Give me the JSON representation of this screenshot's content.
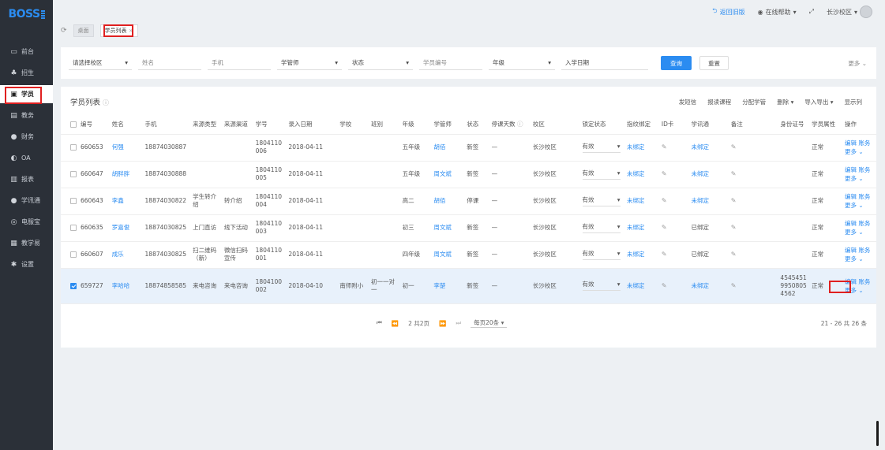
{
  "logo": {
    "text": "BOSS"
  },
  "sidebar": {
    "items": [
      {
        "label": "前台",
        "icon": "calendar-icon"
      },
      {
        "label": "招生",
        "icon": "users-icon"
      },
      {
        "label": "学员",
        "icon": "id-card-icon"
      },
      {
        "label": "教务",
        "icon": "book-icon"
      },
      {
        "label": "财务",
        "icon": "money-icon"
      },
      {
        "label": "OA",
        "icon": "toggle-icon"
      },
      {
        "label": "报表",
        "icon": "bar-chart-icon"
      },
      {
        "label": "学讯通",
        "icon": "message-icon"
      },
      {
        "label": "电服宝",
        "icon": "phone-icon"
      },
      {
        "label": "教学易",
        "icon": "teach-icon"
      },
      {
        "label": "设置",
        "icon": "gear-icon"
      }
    ]
  },
  "topbar": {
    "back": "返回旧版",
    "help": "在线帮助",
    "campus": "长沙校区"
  },
  "tabs": {
    "home": "桌面",
    "current": "学员列表"
  },
  "filter": {
    "campus": "请选择校区",
    "name": "姓名",
    "phone": "手机",
    "manager": "学管师",
    "status": "状态",
    "student_no": "学员编号",
    "grade": "年级",
    "enroll_date": "入学日期",
    "query": "查询",
    "reset": "重置",
    "more": "更多"
  },
  "panel": {
    "title": "学员列表",
    "actions": [
      "发短信",
      "报读课程",
      "分配学管",
      "删除",
      "导入导出",
      "显示列"
    ]
  },
  "table": {
    "headers": [
      "编号",
      "姓名",
      "手机",
      "来源类型",
      "来源渠道",
      "学号",
      "录入日期",
      "学校",
      "班别",
      "年级",
      "学管师",
      "状态",
      "停课天数",
      "校区",
      "锁定状态",
      "指纹绑定",
      "ID卡",
      "学讯通",
      "备注",
      "身份证号",
      "学员属性",
      "操作"
    ],
    "rows": [
      {
        "id": "660653",
        "name": "何强",
        "phone": "18874030887",
        "src_type": "",
        "src_channel": "",
        "sno": "1804110006",
        "date": "2018-04-11",
        "school": "",
        "class": "",
        "grade": "五年级",
        "mgr": "胡佰",
        "status": "新签",
        "stop": "—",
        "campus": "长沙校区",
        "lock": "有效",
        "finger": "未绑定",
        "xxt": "未绑定",
        "idno": "",
        "attr": "正常"
      },
      {
        "id": "660647",
        "name": "胡胖胖",
        "phone": "18874030888",
        "src_type": "",
        "src_channel": "",
        "sno": "1804110005",
        "date": "2018-04-11",
        "school": "",
        "class": "",
        "grade": "五年级",
        "mgr": "周文斌",
        "status": "新签",
        "stop": "—",
        "campus": "长沙校区",
        "lock": "有效",
        "finger": "未绑定",
        "xxt": "未绑定",
        "idno": "",
        "attr": "正常"
      },
      {
        "id": "660643",
        "name": "李鑫",
        "phone": "18874030822",
        "src_type": "学生转介绍",
        "src_channel": "转介绍",
        "sno": "1804110004",
        "date": "2018-04-11",
        "school": "",
        "class": "",
        "grade": "高二",
        "mgr": "胡佰",
        "status": "停课",
        "stop": "—",
        "campus": "长沙校区",
        "lock": "有效",
        "finger": "未绑定",
        "xxt": "未绑定",
        "idno": "",
        "attr": "正常"
      },
      {
        "id": "660635",
        "name": "罗嘉俊",
        "phone": "18874030825",
        "src_type": "上门直访",
        "src_channel": "线下活动",
        "sno": "1804110003",
        "date": "2018-04-11",
        "school": "",
        "class": "",
        "grade": "初三",
        "mgr": "周文斌",
        "status": "新签",
        "stop": "—",
        "campus": "长沙校区",
        "lock": "有效",
        "finger": "未绑定",
        "xxt": "已绑定",
        "idno": "",
        "attr": "正常"
      },
      {
        "id": "660607",
        "name": "成乐",
        "phone": "18874030825",
        "src_type": "扫二维码（新）",
        "src_channel": "微信扫码宣传",
        "sno": "1804110001",
        "date": "2018-04-11",
        "school": "",
        "class": "",
        "grade": "四年级",
        "mgr": "周文斌",
        "status": "新签",
        "stop": "—",
        "campus": "长沙校区",
        "lock": "有效",
        "finger": "未绑定",
        "xxt": "已绑定",
        "idno": "",
        "attr": "正常"
      },
      {
        "id": "659727",
        "name": "李哈哈",
        "phone": "18874858585",
        "src_type": "来电咨询",
        "src_channel": "来电咨询",
        "sno": "1804100002",
        "date": "2018-04-10",
        "school": "南师附小",
        "class": "初一一对一",
        "grade": "初一",
        "mgr": "李楚",
        "status": "新签",
        "stop": "—",
        "campus": "长沙校区",
        "lock": "有效",
        "finger": "未绑定",
        "xxt": "未绑定",
        "idno": "454545199508054562",
        "attr": "正常"
      }
    ],
    "op_edit": "编辑",
    "op_account": "账务",
    "op_more": "更多"
  },
  "pager": {
    "page": "2 共2页",
    "per_page": "每页20条",
    "count": "21 - 26 共 26 条"
  }
}
